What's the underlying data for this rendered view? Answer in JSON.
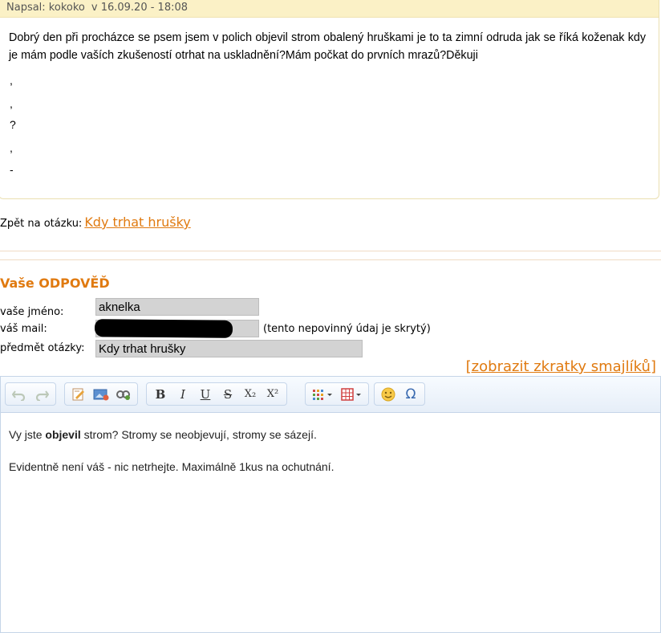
{
  "question": {
    "author_prefix": "Napsal: kokoko",
    "date": "v 16.09.20 - 18:08",
    "text": "Dobrý den při procházce se psem jsem v polich objevil strom obalený hruškami je to ta zimní odruda jak se říká koženak kdy je mám podle vaších zkušeností otrhat na uskladnění?Mám počkat do prvních mrazů?Děkuji",
    "extra_lines": [
      ",",
      ",",
      "?",
      ",",
      "-"
    ]
  },
  "back": {
    "label": "Zpět na otázku:",
    "link": "Kdy trhat hrušky"
  },
  "form": {
    "heading": "Vaše ODPOVĚĎ",
    "name_label": "vaše jméno:",
    "name_value": "aknelka",
    "mail_label": "váš mail:",
    "mail_hint": "(tento nepovinný údaj je skrytý)",
    "subject_label": "předmět otázky:",
    "subject_value": "Kdy trhat hrušky",
    "smileys_link": "[zobrazit zkratky smajlíků]"
  },
  "toolbar": {
    "undo": "undo-icon",
    "redo": "redo-icon",
    "edit": "edit-icon",
    "image": "image-icon",
    "link": "link-icon",
    "bold": "B",
    "italic": "I",
    "underline": "U",
    "strike": "S",
    "sub": "X₂",
    "sup": "X²",
    "omega": "Ω"
  },
  "editor": {
    "line1_pre": "Vy jste ",
    "line1_bold": "objevil",
    "line1_post": " strom? Stromy se neobjevují, stromy se sázejí.",
    "line2": "Evidentně není váš - nic netrhejte. Maximálně 1kus na ochutnání."
  }
}
